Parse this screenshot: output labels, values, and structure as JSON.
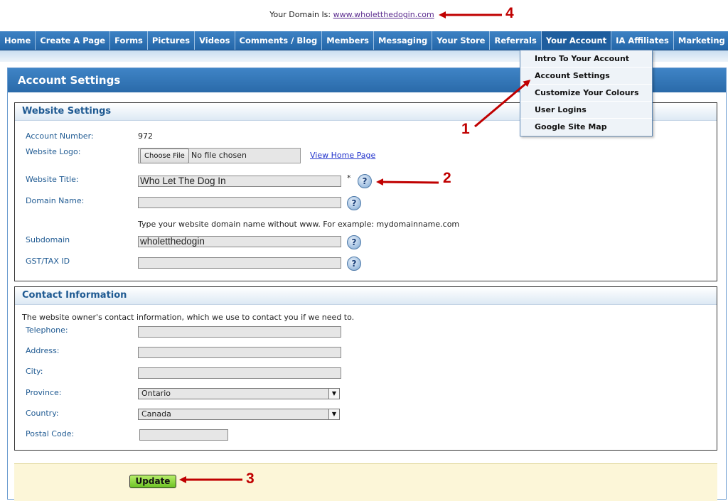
{
  "domain": {
    "label": "Your Domain Is:",
    "url": "www.wholetthedogin.com"
  },
  "nav": {
    "items": [
      "Home",
      "Create A Page",
      "Forms",
      "Pictures",
      "Videos",
      "Comments / Blog",
      "Members",
      "Messaging",
      "Your Store",
      "Referrals",
      "Your Account",
      "IA Affiliates",
      "Marketing"
    ],
    "active": "Your Account"
  },
  "dropdown": {
    "items": [
      "Intro To Your Account",
      "Account Settings",
      "Customize Your Colours",
      "User Logins",
      "Google Site Map"
    ]
  },
  "page_title": "Account Settings",
  "website_settings": {
    "title": "Website Settings",
    "account_number_label": "Account Number:",
    "account_number": "972",
    "logo_label": "Website Logo:",
    "choose_file": "Choose File",
    "no_file": "No file chosen",
    "view_home": "View Home Page",
    "title_label": "Website Title:",
    "title_value": "Who Let The Dog In",
    "required_mark": "*",
    "domain_label": "Domain Name:",
    "domain_value": "",
    "domain_hint": "Type your website domain name without www. For example: mydomainname.com",
    "subdomain_label": "Subdomain",
    "subdomain_value": "wholetthedogin",
    "gst_label": "GST/TAX ID",
    "gst_value": "",
    "help_glyph": "?"
  },
  "contact": {
    "title": "Contact Information",
    "intro": "The website owner's contact information, which we use to contact you if we need to.",
    "telephone_label": "Telephone:",
    "address_label": "Address:",
    "city_label": "City:",
    "province_label": "Province:",
    "province_value": "Ontario",
    "country_label": "Country:",
    "country_value": "Canada",
    "postal_label": "Postal Code:"
  },
  "update_label": "Update",
  "callouts": {
    "one": "1",
    "two": "2",
    "three": "3",
    "four": "4"
  },
  "colors": {
    "nav_blue": "#2e74b8",
    "label_blue": "#1f5a92",
    "callout_red": "#c00000",
    "update_green": "#8ad63e"
  }
}
